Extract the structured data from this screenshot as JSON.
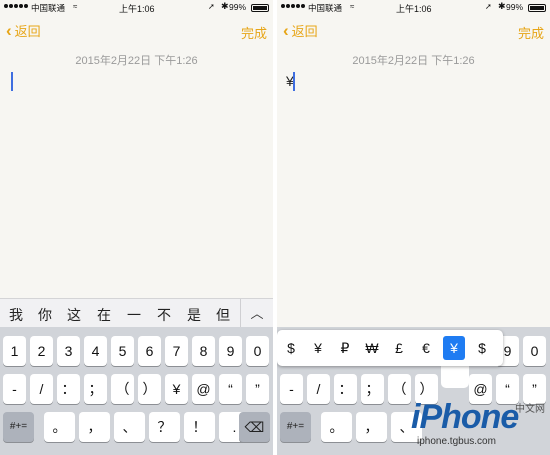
{
  "status": {
    "carrier": "中国联通",
    "wifi": "≈",
    "time": "上午1:06",
    "location": "➚",
    "bluetooth": "✱",
    "battery": "99%"
  },
  "nav": {
    "back_label": "返回",
    "back_chevron": "‹",
    "done_label": "完成"
  },
  "note": {
    "date": "2015年2月22日 下午1:26",
    "typed_text": "¥"
  },
  "candidates": [
    "我",
    "你",
    "这",
    "在",
    "一",
    "不",
    "是",
    "但"
  ],
  "candidates_expand": "︿",
  "keyboard": {
    "row1": [
      "1",
      "2",
      "3",
      "4",
      "5",
      "6",
      "7",
      "8",
      "9",
      "0"
    ],
    "row2": [
      "-",
      "/",
      "：",
      "；",
      "（",
      "）",
      "¥",
      "@",
      "“",
      "”"
    ],
    "row3_mode": "#+=",
    "row3": [
      "。",
      "，",
      "、",
      "？",
      "！",
      "."
    ],
    "delete_icon": "⌫"
  },
  "symbol_popup": {
    "symbols": [
      "$",
      "¥",
      "₽",
      "₩",
      "£",
      "€",
      "¥",
      "$"
    ],
    "selected_index": 6
  },
  "watermark": {
    "brand": "iPhone",
    "cn": "中文网",
    "url": "iphone.tgbus.com"
  }
}
